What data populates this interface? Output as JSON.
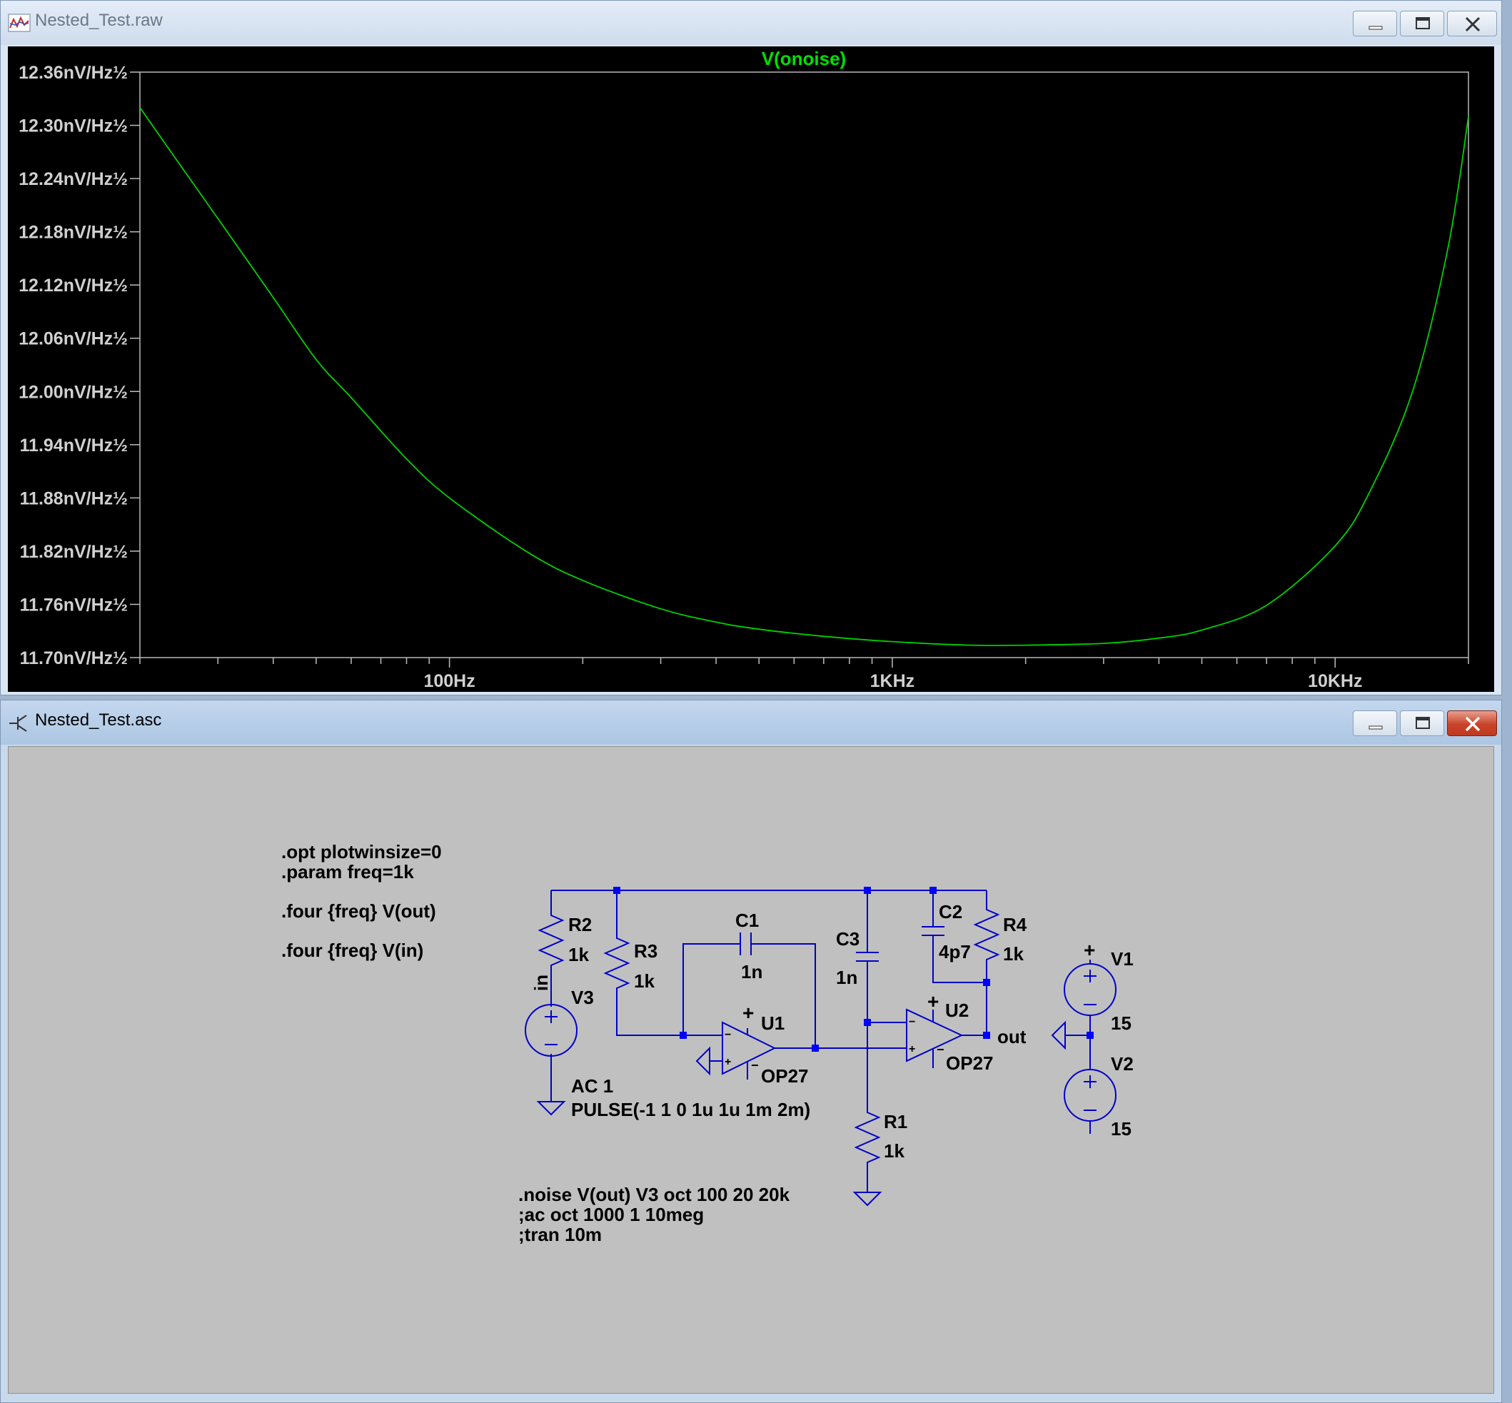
{
  "plot_window": {
    "title": "Nested_Test.raw",
    "icon": "waveform-icon",
    "buttons": {
      "minimize": "minimize-icon",
      "maximize": "maximize-icon",
      "close": "close-icon"
    }
  },
  "chart_data": {
    "type": "line",
    "title": "V(onoise)",
    "x_scale": "log",
    "xlim": [
      20,
      20000
    ],
    "x_ticks": [
      {
        "value": 100,
        "label": "100Hz"
      },
      {
        "value": 1000,
        "label": "1KHz"
      },
      {
        "value": 10000,
        "label": "10KHz"
      }
    ],
    "ylim": [
      11.7,
      12.36
    ],
    "y_ticks": [
      {
        "value": 12.36,
        "label": "12.36nV/Hz½"
      },
      {
        "value": 12.3,
        "label": "12.30nV/Hz½"
      },
      {
        "value": 12.24,
        "label": "12.24nV/Hz½"
      },
      {
        "value": 12.18,
        "label": "12.18nV/Hz½"
      },
      {
        "value": 12.12,
        "label": "12.12nV/Hz½"
      },
      {
        "value": 12.06,
        "label": "12.06nV/Hz½"
      },
      {
        "value": 12.0,
        "label": "12.00nV/Hz½"
      },
      {
        "value": 11.94,
        "label": "11.94nV/Hz½"
      },
      {
        "value": 11.88,
        "label": "11.88nV/Hz½"
      },
      {
        "value": 11.82,
        "label": "11.82nV/Hz½"
      },
      {
        "value": 11.76,
        "label": "11.76nV/Hz½"
      },
      {
        "value": 11.7,
        "label": "11.70nV/Hz½"
      }
    ],
    "grid": false,
    "series": [
      {
        "name": "V(onoise)",
        "color": "#00d000",
        "x": [
          20,
          25,
          30,
          40,
          50,
          60,
          80,
          100,
          150,
          200,
          300,
          400,
          500,
          700,
          1000,
          1500,
          2000,
          3000,
          4000,
          5000,
          7000,
          10000,
          12000,
          15000,
          18000,
          20000
        ],
        "y": [
          12.32,
          12.251,
          12.195,
          12.106,
          12.036,
          11.993,
          11.924,
          11.88,
          11.819,
          11.787,
          11.755,
          11.74,
          11.732,
          11.724,
          11.718,
          11.714,
          11.714,
          11.716,
          11.722,
          11.731,
          11.759,
          11.826,
          11.888,
          12.002,
          12.163,
          12.31
        ]
      }
    ],
    "colors": {
      "background": "#000000",
      "axis": "#bdbdbd",
      "label": "#d0d0d0",
      "title": "#00e000"
    }
  },
  "schematic_window": {
    "title": "Nested_Test.asc",
    "icon": "transistor-icon",
    "buttons": {
      "minimize": "minimize-icon",
      "maximize": "maximize-icon",
      "close": "close-icon"
    },
    "directives": {
      "opt": ".opt plotwinsize=0",
      "param": ".param freq=1k",
      "four_out": ".four {freq} V(out)",
      "four_in": ".four {freq} V(in)",
      "noise": ".noise V(out) V3 oct 100 20 20k",
      "ac": ";ac oct 1000 1 10meg",
      "tran": ";tran 10m"
    },
    "components": {
      "R1": {
        "name": "R1",
        "value": "1k"
      },
      "R2": {
        "name": "R2",
        "value": "1k"
      },
      "R3": {
        "name": "R3",
        "value": "1k"
      },
      "R4": {
        "name": "R4",
        "value": "1k"
      },
      "C1": {
        "name": "C1",
        "value": "1n"
      },
      "C2": {
        "name": "C2",
        "value": "4p7"
      },
      "C3": {
        "name": "C3",
        "value": "1n"
      },
      "U1": {
        "name": "U1",
        "model": "OP27"
      },
      "U2": {
        "name": "U2",
        "model": "OP27"
      },
      "V1": {
        "name": "V1",
        "value": "15"
      },
      "V2": {
        "name": "V2",
        "value": "15"
      },
      "V3": {
        "name": "V3",
        "ac": "AC 1",
        "pulse": "PULSE(-1 1 0 1u 1u 1m 2m)"
      }
    },
    "net_labels": {
      "in": "in",
      "out": "out"
    },
    "symbols": {
      "plus": "+",
      "minus": "−"
    },
    "colors": {
      "wire": "#0000c8",
      "junction": "#0000ff",
      "text": "#000000",
      "background": "#c0c0c0"
    }
  }
}
